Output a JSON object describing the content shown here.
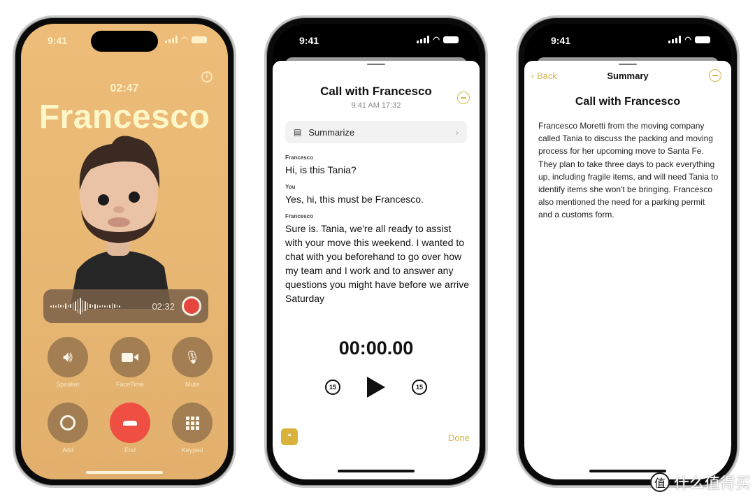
{
  "phone1": {
    "status_time": "9:41",
    "call_duration": "02:47",
    "caller_name": "Francesco",
    "recording": {
      "elapsed": "02:32"
    },
    "controls": [
      {
        "label": "Speaker",
        "icon": "speaker-icon"
      },
      {
        "label": "FaceTime",
        "icon": "video-icon"
      },
      {
        "label": "Mute",
        "icon": "mic-slash-icon"
      },
      {
        "label": "Add",
        "icon": "add-call-icon"
      },
      {
        "label": "End",
        "icon": "end-call-icon"
      },
      {
        "label": "Keypad",
        "icon": "keypad-icon"
      }
    ],
    "colors": {
      "background": "#e8b774",
      "end": "#ee4f42"
    }
  },
  "phone2": {
    "status_time": "9:41",
    "title": "Call with Francesco",
    "subtitle": "9:41 AM  17:32",
    "summarize_label": "Summarize",
    "transcript": [
      {
        "speaker": "Francesco",
        "text": "Hi, is this Tania?"
      },
      {
        "speaker": "You",
        "text": "Yes, hi, this must be Francesco."
      },
      {
        "speaker": "Francesco",
        "text": "Sure is. Tania, we're all ready to assist with your move this weekend. I wanted to chat with you beforehand to go over how my team and I work and to answer any questions you might have before we arrive Saturday"
      }
    ],
    "playback_time": "00:00.00",
    "skip_back": "15",
    "skip_forward": "15",
    "done_label": "Done",
    "accent": "#d1b84b"
  },
  "phone3": {
    "status_time": "9:41",
    "back_label": "Back",
    "nav_title": "Summary",
    "title": "Call with Francesco",
    "summary": "Francesco Moretti from the moving company called Tania to discuss the packing and moving process for her upcoming move to Santa Fe. They plan to take three days to pack everything up, including fragile items, and will need Tania to identify items she won't be bringing. Francesco also mentioned the need for a parking permit and a customs form."
  },
  "watermark": {
    "badge": "值",
    "text": "什么值得买"
  }
}
